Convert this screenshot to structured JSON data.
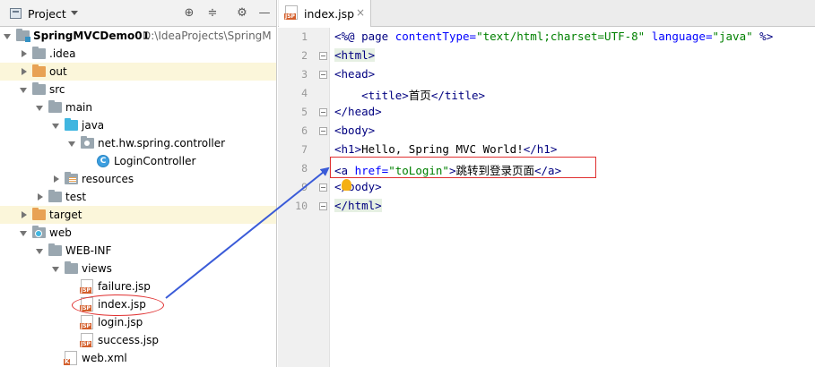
{
  "project_panel": {
    "title": "Project",
    "tree": [
      {
        "label": "SpringMVCDemo01",
        "path": "D:\\IdeaProjects\\SpringM",
        "indent": 0,
        "icon": "module-folder",
        "expanded": true,
        "bold": true
      },
      {
        "label": ".idea",
        "indent": 1,
        "icon": "folder-gray",
        "expanded": false
      },
      {
        "label": "out",
        "indent": 1,
        "icon": "folder-orange",
        "expanded": false,
        "highlight": true
      },
      {
        "label": "src",
        "indent": 1,
        "icon": "folder-gray",
        "expanded": true
      },
      {
        "label": "main",
        "indent": 2,
        "icon": "folder-gray",
        "expanded": true
      },
      {
        "label": "java",
        "indent": 3,
        "icon": "folder-blue",
        "expanded": true
      },
      {
        "label": "net.hw.spring.controller",
        "indent": 4,
        "icon": "package",
        "expanded": true
      },
      {
        "label": "LoginController",
        "indent": 5,
        "icon": "class"
      },
      {
        "label": "resources",
        "indent": 3,
        "icon": "folder-resources",
        "expanded": false
      },
      {
        "label": "test",
        "indent": 2,
        "icon": "folder-gray",
        "expanded": false
      },
      {
        "label": "target",
        "indent": 1,
        "icon": "folder-orange",
        "expanded": false,
        "highlight": true
      },
      {
        "label": "web",
        "indent": 1,
        "icon": "folder-web",
        "expanded": true
      },
      {
        "label": "WEB-INF",
        "indent": 2,
        "icon": "folder-gray",
        "expanded": true
      },
      {
        "label": "views",
        "indent": 3,
        "icon": "folder-gray",
        "expanded": true
      },
      {
        "label": "failure.jsp",
        "indent": 4,
        "icon": "jsp-file"
      },
      {
        "label": "index.jsp",
        "indent": 4,
        "icon": "jsp-file",
        "circled": true
      },
      {
        "label": "login.jsp",
        "indent": 4,
        "icon": "jsp-file"
      },
      {
        "label": "success.jsp",
        "indent": 4,
        "icon": "jsp-file"
      },
      {
        "label": "web.xml",
        "indent": 3,
        "icon": "xml-file"
      }
    ]
  },
  "editor": {
    "tab_label": "index.jsp",
    "tab_close": "×",
    "lines": [
      [
        [
          "t",
          "<%@ "
        ],
        [
          "t",
          "page "
        ],
        [
          "a",
          "contentType="
        ],
        [
          "s",
          "\"text/html;charset=UTF-8\""
        ],
        [
          "tx",
          " "
        ],
        [
          "a",
          "language="
        ],
        [
          "s",
          "\"java\""
        ],
        [
          "tx",
          " "
        ],
        [
          "t",
          "%>"
        ]
      ],
      [
        [
          "tg",
          "<html>"
        ]
      ],
      [
        [
          "t",
          "<head>"
        ]
      ],
      [
        [
          "tx",
          "    "
        ],
        [
          "t",
          "<title>"
        ],
        [
          "tx",
          "首页"
        ],
        [
          "t",
          "</title>"
        ]
      ],
      [
        [
          "t",
          "</head>"
        ]
      ],
      [
        [
          "t",
          "<body>"
        ]
      ],
      [
        [
          "t",
          "<h1>"
        ],
        [
          "tx",
          "Hello, Spring MVC World!"
        ],
        [
          "t",
          "</h1>"
        ]
      ],
      [
        [
          "t",
          "<a "
        ],
        [
          "a",
          "href="
        ],
        [
          "s",
          "\"toLogin\""
        ],
        [
          "t",
          ">"
        ],
        [
          "tx",
          "跳转到登录页面"
        ],
        [
          "t",
          "</a>"
        ]
      ],
      [
        [
          "t",
          "</body>"
        ]
      ],
      [
        [
          "tg",
          "</html>"
        ]
      ]
    ]
  },
  "colors": {
    "tag": "#000080",
    "attr": "#0000ff",
    "string": "#008000",
    "annotation_red": "#e03030",
    "arrow_blue": "#3a5bd8"
  }
}
